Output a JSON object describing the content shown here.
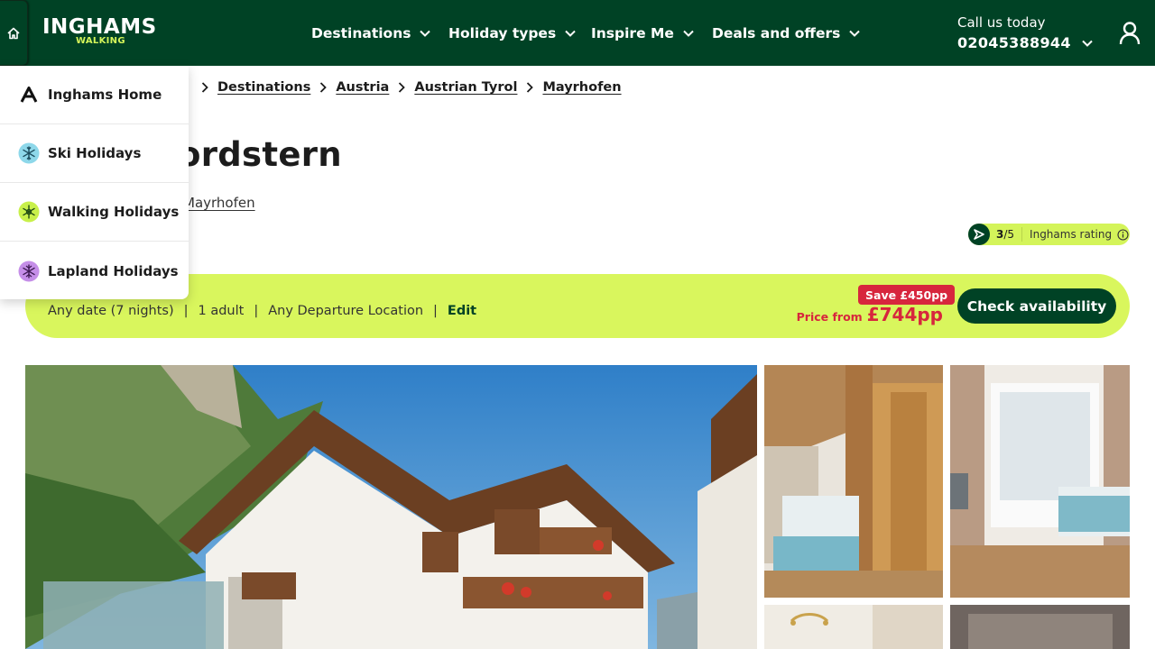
{
  "header": {
    "brand": "INGHAMS",
    "brand_sub": "WALKING",
    "nav": [
      {
        "label": "Destinations"
      },
      {
        "label": "Holiday types"
      },
      {
        "label": "Inspire Me"
      },
      {
        "label": "Deals and offers"
      }
    ],
    "call_label": "Call us today",
    "phone": "02045388944"
  },
  "brand_menu": {
    "items": [
      {
        "label": "Inghams Home",
        "icon": "inghams-logo-icon"
      },
      {
        "label": "Ski Holidays",
        "icon": "snowflake-icon",
        "color": "#8ed8ea"
      },
      {
        "label": "Walking Holidays",
        "icon": "walking-icon",
        "color": "#c8f04a"
      },
      {
        "label": "Lapland Holidays",
        "icon": "lapland-icon",
        "color": "#c58ee8"
      }
    ]
  },
  "breadcrumb": [
    "Destinations",
    "Austria",
    "Austrian Tyrol",
    "Mayrhofen"
  ],
  "hotel": {
    "title_visible": "ordstern",
    "location_visible": "Mayrhofen"
  },
  "rating": {
    "score": "3",
    "out_of": "/5",
    "label": "Inghams rating"
  },
  "availability": {
    "date": "Any date (7 nights)",
    "guests": "1 adult",
    "departure": "Any Departure Location",
    "edit_label": "Edit",
    "save_badge": "Save £450pp",
    "price_label": "Price from",
    "price": "£744pp",
    "cta": "Check availability"
  },
  "colors": {
    "brand_green": "#004225",
    "lime": "#d9f65d",
    "sale_red": "#d7263d"
  }
}
